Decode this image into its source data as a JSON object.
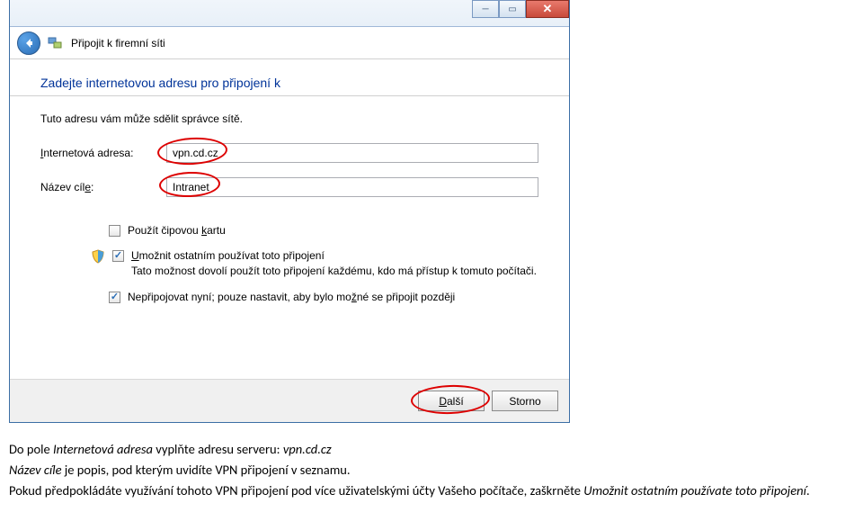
{
  "window": {
    "header_title": "Připojit k firemní síti",
    "heading": "Zadejte internetovou adresu pro připojení k",
    "hint": "Tuto adresu vám může sdělit správce sítě.",
    "label_address_pre": "",
    "label_address_key": "I",
    "label_address_post": "nternetová adresa:",
    "label_dest_pre": "Název cíl",
    "label_dest_key": "e",
    "label_dest_post": ":",
    "input_address": "vpn.cd.cz",
    "input_dest": "Intranet",
    "chk_smartcard_pre": "Použít čipovou ",
    "chk_smartcard_key": "k",
    "chk_smartcard_post": "artu",
    "chk_allow_pre": "",
    "chk_allow_key": "U",
    "chk_allow_post": "možnit ostatním používat toto připojení",
    "chk_allow_desc": "Tato možnost dovolí použít toto připojení každému, kdo má přístup k tomuto počítači.",
    "chk_later_pre": "Nepřipojovat nyní; pouze nastavit, aby bylo mo",
    "chk_later_key": "ž",
    "chk_later_post": "né se připojit později",
    "btn_next_pre": "",
    "btn_next_key": "D",
    "btn_next_post": "alší",
    "btn_cancel": "Storno"
  },
  "doc": {
    "line1_a": "Do pole ",
    "line1_b": "Internetová adresa",
    "line1_c": " vyplňte adresu serveru: ",
    "line1_d": "vpn.cd.cz",
    "line2_a": "Název cíle",
    "line2_b": " je popis, pod kterým uvidíte VPN připojení v seznamu.",
    "line3_a": "Pokud předpokládáte využívání tohoto VPN připojení pod více uživatelskými účty Vašeho počítače, zaškrněte ",
    "line3_b": "Umožnit ostatním používate toto připojení",
    "line3_c": "."
  }
}
